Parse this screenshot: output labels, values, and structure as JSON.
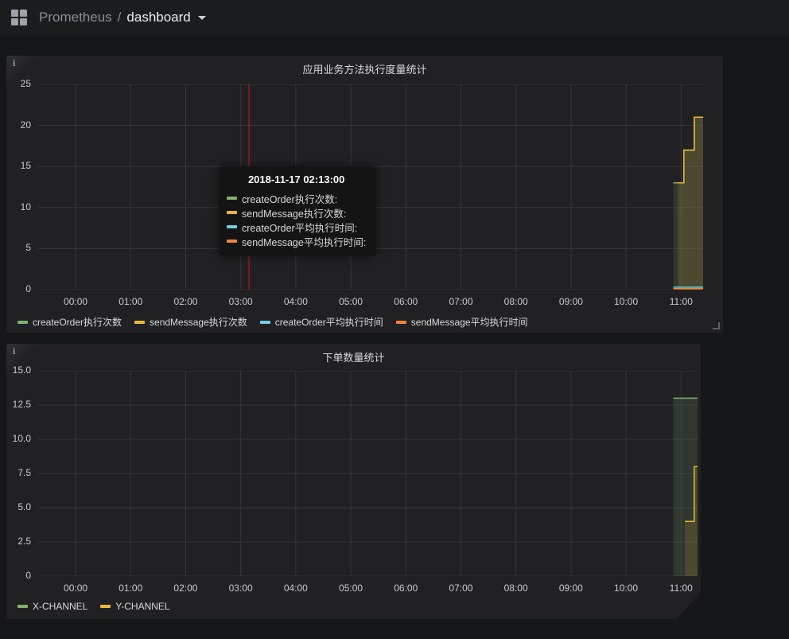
{
  "header": {
    "breadcrumb_prefix": "Prometheus",
    "separator": "/",
    "dashboard_name": "dashboard"
  },
  "theme": {
    "page_bg": "#161719",
    "panel_bg": "#212124",
    "grid": "#34373c",
    "tick_text": "#c9cbce",
    "crosshair": "#9a1a1f",
    "tooltip_bg": "#141414",
    "green": "#7eb26d",
    "yellow": "#eab839",
    "cyan": "#6ed0e0",
    "orange": "#ef843c"
  },
  "panels": [
    {
      "info_icon": "i"
    },
    {
      "info_icon": "i"
    }
  ],
  "tooltip": {
    "title": "2018-11-17 02:13:00",
    "items": [
      {
        "label": "createOrder执行次数:",
        "color": "#7eb26d"
      },
      {
        "label": "sendMessage执行次数:",
        "color": "#eab839"
      },
      {
        "label": "createOrder平均执行时间:",
        "color": "#6ed0e0"
      },
      {
        "label": "sendMessage平均执行时间:",
        "color": "#ef843c"
      }
    ]
  },
  "chart_data": [
    {
      "type": "line",
      "title": "应用业务方法执行度量统计",
      "x_tick_labels": [
        "00:00",
        "01:00",
        "02:00",
        "03:00",
        "04:00",
        "05:00",
        "06:00",
        "07:00",
        "08:00",
        "09:00",
        "10:00",
        "11:00"
      ],
      "x_tick_hours": [
        0,
        1,
        2,
        3,
        4,
        5,
        6,
        7,
        8,
        9,
        10,
        11
      ],
      "x_range_hours": [
        -0.68,
        11.4
      ],
      "ylim": [
        0,
        25
      ],
      "y_ticks": [
        0,
        5,
        10,
        15,
        20,
        25
      ],
      "y_tick_labels": [
        "0",
        "5",
        "10",
        "15",
        "20",
        "25"
      ],
      "grid": true,
      "legend_position": "bottom",
      "crosshair_hour": 3.15,
      "crosshair_time": "02:13:00",
      "series": [
        {
          "name": "createOrder执行次数",
          "color": "#7eb26d",
          "fill_opacity": 0.15,
          "points": [
            [
              10.86,
              13
            ],
            [
              11.05,
              13
            ],
            [
              11.05,
              17
            ],
            [
              11.24,
              17
            ],
            [
              11.24,
              21
            ],
            [
              11.4,
              21
            ]
          ]
        },
        {
          "name": "sendMessage执行次数",
          "color": "#eab839",
          "fill_opacity": 0.15,
          "points": [
            [
              10.94,
              13
            ],
            [
              11.05,
              13
            ],
            [
              11.05,
              17
            ],
            [
              11.24,
              17
            ],
            [
              11.24,
              21
            ],
            [
              11.4,
              21
            ]
          ]
        },
        {
          "name": "createOrder平均执行时间",
          "color": "#6ed0e0",
          "fill_opacity": 0,
          "points": [
            [
              10.86,
              0.3
            ],
            [
              11.4,
              0.3
            ]
          ]
        },
        {
          "name": "sendMessage平均执行时间",
          "color": "#ef843c",
          "fill_opacity": 0,
          "points": [
            [
              10.86,
              0.12
            ],
            [
              11.4,
              0.12
            ]
          ]
        }
      ]
    },
    {
      "type": "line",
      "title": "下单数量统计",
      "x_tick_labels": [
        "00:00",
        "01:00",
        "02:00",
        "03:00",
        "04:00",
        "05:00",
        "06:00",
        "07:00",
        "08:00",
        "09:00",
        "10:00",
        "11:00"
      ],
      "x_tick_hours": [
        0,
        1,
        2,
        3,
        4,
        5,
        6,
        7,
        8,
        9,
        10,
        11
      ],
      "x_range_hours": [
        -0.68,
        11.3
      ],
      "ylim": [
        0,
        15
      ],
      "y_ticks": [
        0,
        2.5,
        5,
        7.5,
        10,
        12.5,
        15
      ],
      "y_tick_labels": [
        "0",
        "2.5",
        "5.0",
        "7.5",
        "10.0",
        "12.5",
        "15.0"
      ],
      "grid": true,
      "legend_position": "bottom",
      "series": [
        {
          "name": "X-CHANNEL",
          "color": "#7eb26d",
          "fill_opacity": 0.15,
          "points": [
            [
              10.86,
              13
            ],
            [
              11.3,
              13
            ]
          ]
        },
        {
          "name": "Y-CHANNEL",
          "color": "#eab839",
          "fill_opacity": 0.15,
          "points": [
            [
              11.07,
              4
            ],
            [
              11.24,
              4
            ],
            [
              11.24,
              8
            ],
            [
              11.3,
              8
            ]
          ]
        }
      ]
    }
  ]
}
